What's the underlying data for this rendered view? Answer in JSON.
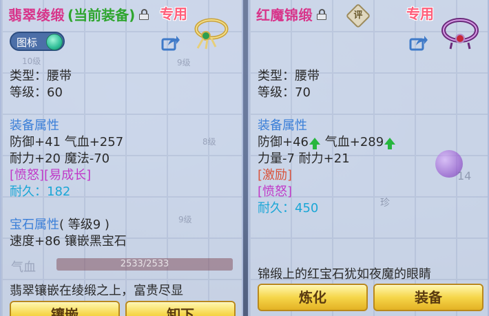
{
  "left": {
    "name": "翡翠绫缎",
    "status": "(当前装备)",
    "special_badge": "专用",
    "toggle_label": "图标",
    "ghost_slot_top": "10级",
    "ghost_slot_label": "9级",
    "ghost_slot_label2": "8级",
    "ghost_slot_label3": "9级",
    "type_line": "类型：腰带",
    "level_line": "等级：60",
    "attr_header": "装备属性",
    "attr_line1": "防御+41 气血+257",
    "attr_line2": "耐力+20 魔法-70",
    "tags": "[愤怒][易成长]",
    "durability_label": "耐久：",
    "durability_value": "182",
    "gem_header": "宝石属性",
    "gem_level": "( 等级9 )",
    "gem_line": "速度+86 镶嵌黑宝石",
    "ghost_hp_label": "气血",
    "ghost_hp_value": "2533/2533",
    "description": "翡翠镶嵌在绫缎之上，富贵尽显",
    "btn1": "镶嵌",
    "btn2": "卸下"
  },
  "right": {
    "name": "红魔锦缎",
    "rate_label": "评",
    "special_badge": "专用",
    "ghost_count": "14",
    "ghost_slot": "珍",
    "type_line": "类型：腰带",
    "level_line": "等级：70",
    "attr_header": "装备属性",
    "attr_def": "防御+46",
    "attr_hp": "气血+289",
    "attr_line2": "力量-7 耐力+21",
    "tag1": "[激励]",
    "tag2": "[愤怒]",
    "durability_label": "耐久：",
    "durability_value": "450",
    "description": "锦缎上的红宝石犹如夜魔的眼睛",
    "btn1": "炼化",
    "btn2": "装备"
  },
  "colors": {
    "name": "#d8348a",
    "status": "#2ea52e",
    "header": "#3b7fd8",
    "tag": "#c038c8",
    "tag_red": "#d9533b",
    "durability": "#1aa6d6",
    "up_arrow": "#27b63e",
    "button": "#f6d64a"
  },
  "icons": [
    "lock-open-icon",
    "share-icon",
    "rate-icon",
    "up-arrow-icon",
    "toggle-knob-icon",
    "belt-item-icon"
  ]
}
